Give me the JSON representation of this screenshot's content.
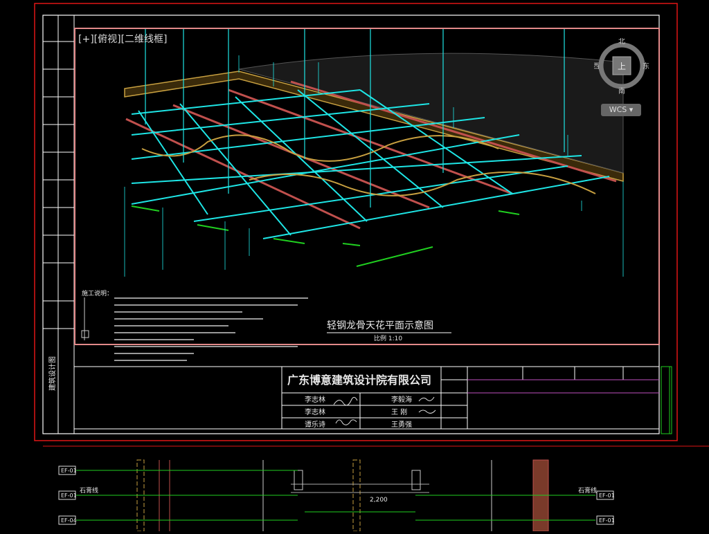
{
  "viewport": {
    "label": "[+][俯视][二维线框]"
  },
  "viewcube": {
    "north": "北",
    "south": "南",
    "east": "东",
    "west": "西",
    "top": "上",
    "wcs": "WCS"
  },
  "drawing": {
    "title": "轻钢龙骨天花平面示意图",
    "scale": "比例 1:10",
    "notes_heading": "施工说明："
  },
  "company": {
    "name": "广东博意建筑设计院有限公司"
  },
  "signatures": [
    "李志林",
    "李志林",
    "谭乐诗",
    "李毅海",
    "王 刚",
    "王勇强"
  ],
  "side_label": "建筑设计图",
  "detail": {
    "dim": "2,200",
    "tags_left": [
      "EF-01",
      "EF-01",
      "EF-04"
    ],
    "tags_right": [
      "EF-01",
      "EF-01"
    ],
    "label_left": "石膏线",
    "label_right": "石膏线"
  },
  "colors": {
    "background": "#000000",
    "frame": "#e01515",
    "viewport_border": "#e38a8a",
    "grid_cyan": "#1ee6e6",
    "joist_red": "#c0504d",
    "joist_orange": "#c8a040",
    "green": "#20d020"
  }
}
